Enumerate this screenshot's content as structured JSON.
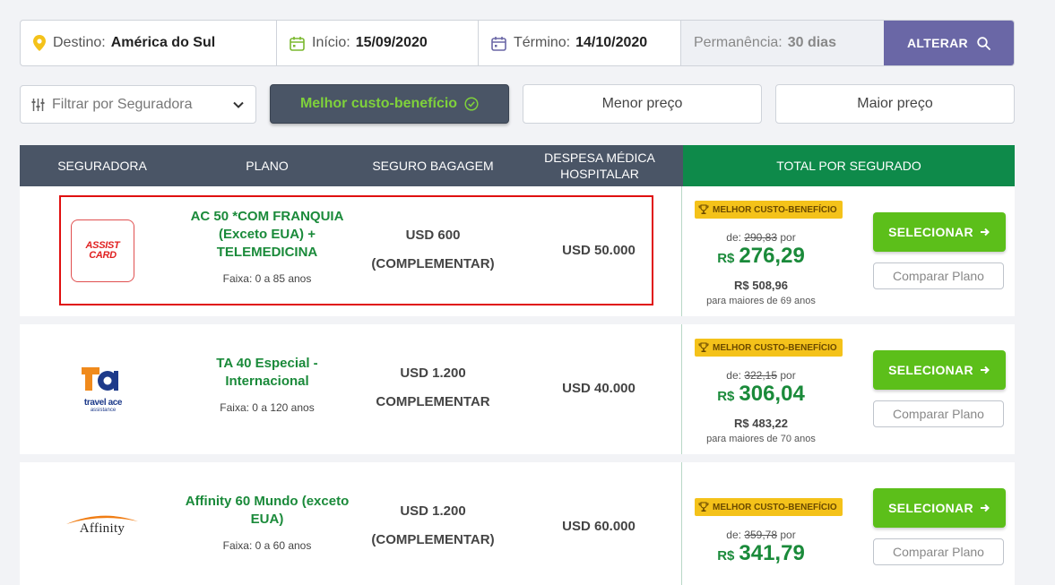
{
  "search": {
    "destino_label": "Destino:",
    "destino_value": "América do Sul",
    "inicio_label": "Início:",
    "inicio_value": "15/09/2020",
    "termino_label": "Término:",
    "termino_value": "14/10/2020",
    "permanencia_label": "Permanência:",
    "permanencia_value": "30 dias",
    "alterar_label": "ALTERAR"
  },
  "filters": {
    "seguradora_placeholder": "Filtrar por Seguradora",
    "tabs": [
      "Melhor custo-benefício",
      "Menor preço",
      "Maior preço"
    ]
  },
  "table": {
    "headers": [
      "SEGURADORA",
      "PLANO",
      "SEGURO BAGAGEM",
      "DESPESA MÉDICA HOSPITALAR",
      "TOTAL POR SEGURADO"
    ],
    "rows": [
      {
        "logo": "ASSIST CARD",
        "plan_name": "AC 50 *COM FRANQUIA (Exceto EUA) + TELEMEDICINA",
        "faixa": "Faixa: 0 a 85 anos",
        "bagagem": "USD 600",
        "bagagem_tipo": "(COMPLEMENTAR)",
        "despesa": "USD 50.000",
        "badge": "MELHOR CUSTO-BENEFÍCIO",
        "de_label": "de:",
        "de_value": "290,83",
        "por_label": "por",
        "currency": "R$",
        "price": "276,29",
        "total": "R$ 508,96",
        "maiores": "para maiores de 69 anos",
        "select_label": "SELECIONAR",
        "compare_label": "Comparar Plano"
      },
      {
        "logo": "travel ace",
        "logo_sub": "assistance",
        "plan_name": "TA 40 Especial - Internacional",
        "faixa": "Faixa: 0 a 120 anos",
        "bagagem": "USD 1.200",
        "bagagem_tipo": "COMPLEMENTAR",
        "despesa": "USD 40.000",
        "badge": "MELHOR CUSTO-BENEFÍCIO",
        "de_label": "de:",
        "de_value": "322,15",
        "por_label": "por",
        "currency": "R$",
        "price": "306,04",
        "total": "R$ 483,22",
        "maiores": "para maiores de 70 anos",
        "select_label": "SELECIONAR",
        "compare_label": "Comparar Plano"
      },
      {
        "logo": "Affinity",
        "plan_name": "Affinity 60 Mundo (exceto EUA)",
        "faixa": "Faixa: 0 a 60 anos",
        "bagagem": "USD 1.200",
        "bagagem_tipo": "(COMPLEMENTAR)",
        "despesa": "USD 60.000",
        "badge": "MELHOR CUSTO-BENEFÍCIO",
        "de_label": "de:",
        "de_value": "359,78",
        "por_label": "por",
        "currency": "R$",
        "price": "341,79",
        "select_label": "SELECIONAR",
        "compare_label": "Comparar Plano"
      }
    ]
  },
  "colors": {
    "header_dark": "#4a5566",
    "header_green": "#0e8a4a",
    "accent_purple": "#6a67a6",
    "price_green": "#1a8a3a",
    "select_green": "#5cbf1a",
    "badge_yellow": "#f4c21a",
    "highlight_red": "#e01010"
  }
}
